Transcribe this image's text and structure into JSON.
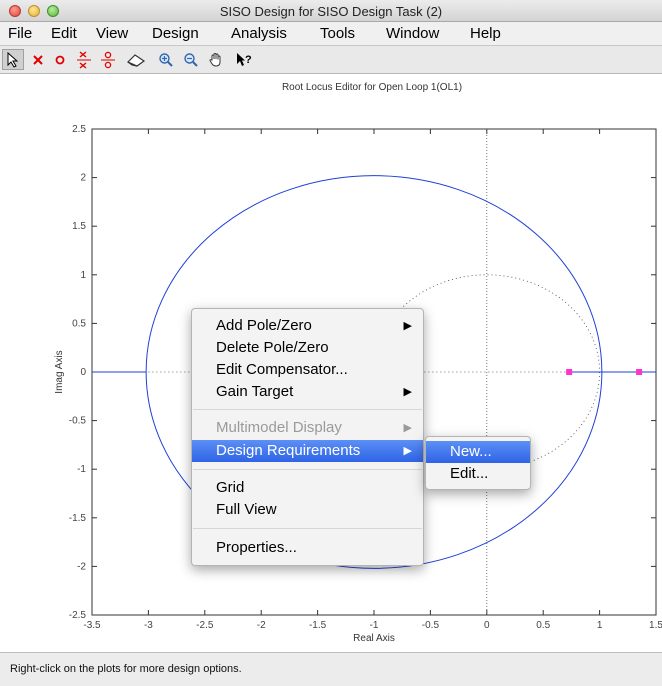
{
  "window": {
    "title": "SISO Design for SISO Design Task (2)"
  },
  "menubar": {
    "items": [
      "File",
      "Edit",
      "View",
      "Design",
      "Analysis",
      "Tools",
      "Window",
      "Help"
    ]
  },
  "toolbar": {
    "tools": [
      "select-arrow-icon",
      "add-pole-icon",
      "add-zero-icon",
      "add-complex-pole-icon",
      "add-complex-zero-icon",
      "eraser-icon",
      "zoom-in-icon",
      "zoom-out-icon",
      "pan-hand-icon",
      "whats-this-icon"
    ],
    "pole_color": "#ff0000"
  },
  "plot": {
    "title": "Root Locus Editor for Open Loop 1(OL1)",
    "xlabel": "Real Axis",
    "ylabel": "Imag Axis",
    "xlim": [
      -3.5,
      1.5
    ],
    "ylim": [
      -2.5,
      2.5
    ],
    "xticks": [
      "-3.5",
      "-3",
      "-2.5",
      "-2",
      "-1.5",
      "-1",
      "-0.5",
      "0",
      "0.5",
      "1",
      "1.5"
    ],
    "yticks": [
      "2.5",
      "2",
      "1.5",
      "1",
      "0.5",
      "0",
      "-0.5",
      "-1",
      "-1.5",
      "-2",
      "-2.5"
    ],
    "locus_color": "#1f3fd6",
    "marker_color": "#ff33cc"
  },
  "chart_data": {
    "type": "line",
    "title": "Root Locus Editor for Open Loop 1(OL1)",
    "xlabel": "Real Axis",
    "ylabel": "Imag Axis",
    "xlim": [
      -3.5,
      1.5
    ],
    "ylim": [
      -2.5,
      2.5
    ],
    "series": [],
    "locus_circle": {
      "center": [
        -1.0,
        0.0
      ],
      "radius_x": 2.02,
      "radius_y": 2.02
    },
    "unit_circle": {
      "center": [
        0,
        0
      ],
      "radius": 1.0,
      "style": "dotted"
    },
    "closed_loop_poles": [
      [
        0.73,
        0.0
      ],
      [
        1.35,
        0.0
      ]
    ]
  },
  "context_menu": {
    "items": [
      {
        "label": "Add Pole/Zero",
        "submenu": true
      },
      {
        "label": "Delete Pole/Zero",
        "submenu": false
      },
      {
        "label": "Edit Compensator...",
        "submenu": false
      },
      {
        "label": "Gain Target",
        "submenu": true
      },
      {
        "label": "Multimodel Display",
        "submenu": true,
        "disabled": true
      },
      {
        "label": "Design Requirements",
        "submenu": true,
        "highlighted": true
      },
      {
        "label": "Grid",
        "submenu": false
      },
      {
        "label": "Full View",
        "submenu": false
      },
      {
        "label": "Properties...",
        "submenu": false
      }
    ],
    "arrow": "▶"
  },
  "submenu": {
    "items": [
      "New...",
      "Edit..."
    ]
  },
  "status": {
    "text": "Right-click on the plots for more design options."
  }
}
